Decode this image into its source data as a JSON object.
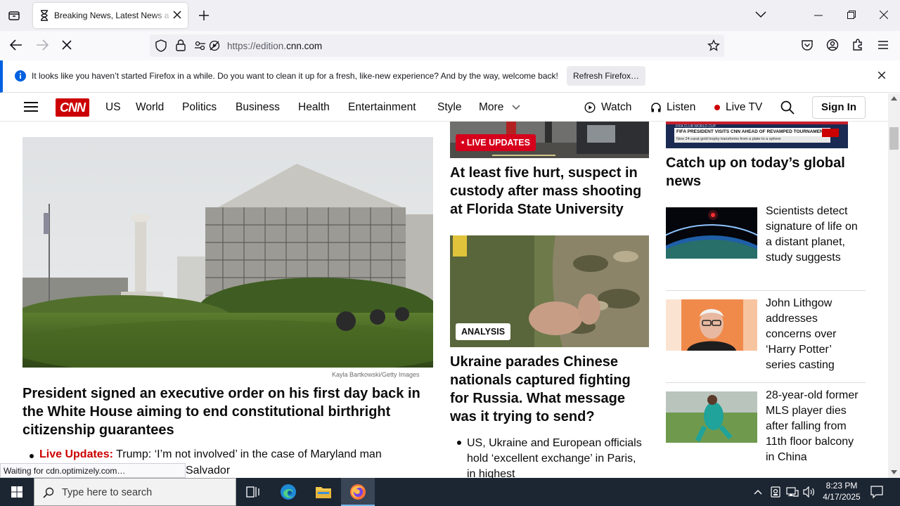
{
  "browser": {
    "tab_title": "Breaking News, Latest News and Videos | CNN",
    "url_prefix": "https://edition.",
    "url_domain": "cnn.com",
    "notification": {
      "message": "It looks like you haven’t started Firefox in a while. Do you want to clean it up for a fresh, like-new experience? And by the way, welcome back!",
      "button": "Refresh Firefox…"
    },
    "status_text": "Waiting for cdn.optimizely.com…"
  },
  "nav": {
    "logo": "CNN",
    "items": [
      "US",
      "World",
      "Politics",
      "Business",
      "Health",
      "Entertainment",
      "Style",
      "More"
    ],
    "watch": "Watch",
    "listen": "Listen",
    "live_tv": "Live TV",
    "sign_in": "Sign In"
  },
  "main_story": {
    "photo_credit": "Kayla Bartkowski/Getty Images",
    "headline": "President signed an executive order on his first day back in the White House aiming to end constitutional birthright citizenship guarantees",
    "bullet_label": "Live Updates:",
    "bullet_text": "Trump: ‘I’m not involved’ in the case of Maryland man",
    "bullet_text_cont": "Salvador"
  },
  "middle_column": {
    "live_badge": "• LIVE UPDATES",
    "story1_headline": "At least five hurt, suspect in custody after mass shooting at Florida State University",
    "analysis_badge": "ANALYSIS",
    "story2_headline": "Ukraine parades Chinese nationals captured fighting for Russia. What message was it trying to send?",
    "story2_bullet": "US, Ukraine and European officials hold ‘excellent exchange’ in Paris, in highest"
  },
  "right_column": {
    "video_title": "FIFA PRESIDENT VISITS CNN AHEAD OF REVAMPED TOURNAMENT",
    "video_sub": "New 24-carat gold trophy transforms from a plate to a sphere",
    "video_tag": "FIFA CLUB WORLD CUP",
    "section_title": "Catch up on today’s global news",
    "items": [
      "Scientists detect signature of life on a distant planet, study suggests",
      "John Lithgow addresses concerns over ‘Harry Potter’ series casting",
      "28-year-old former MLS player dies after falling from 11th floor balcony in China"
    ]
  },
  "taskbar": {
    "search_placeholder": "Type here to search",
    "time": "8:23 PM",
    "date": "4/17/2025"
  },
  "colors": {
    "cnn_red": "#cc0000",
    "live_red": "#d6001c",
    "firefox_blue": "#0060df",
    "taskbar": "#1c2532"
  }
}
